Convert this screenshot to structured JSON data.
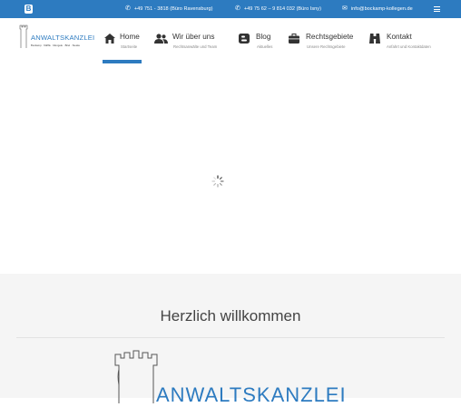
{
  "topbar": {
    "blogger_icon": "blogger-icon",
    "phone1": "+49 751 - 3818 (Büro Ravensburg)",
    "phone2": "+49 75 62 – 9 814 032 (Büro Isny)",
    "email": "info@bockamp-kollegen.de",
    "phone_icon": "phone-icon",
    "mail_icon": "envelope-icon",
    "menu_icon": "hamburger-menu-icon"
  },
  "logo": {
    "name": "ANWALTSKANZLEI",
    "sub": "Bockamp · Kläffle · Mengele · Briel · Sieske"
  },
  "nav": [
    {
      "label": "Home",
      "sub": "Startseite",
      "icon": "home-icon"
    },
    {
      "label": "Wir über uns",
      "sub": "Rechtsanwälte und Team",
      "icon": "users-icon"
    },
    {
      "label": "Blog",
      "sub": "Aktuelles",
      "icon": "blogger-icon"
    },
    {
      "label": "Rechtsgebiete",
      "sub": "Unsere Rechtsgebiete",
      "icon": "briefcase-icon"
    },
    {
      "label": "Kontakt",
      "sub": "Anfahrt und Kontaktdaten",
      "icon": "binoculars-icon"
    }
  ],
  "welcome": {
    "title": "Herzlich willkommen",
    "logo_text": "ANWALTSKANZLEI"
  },
  "colors": {
    "accent": "#2d7bc0",
    "section_bg": "#f5f5f5"
  }
}
